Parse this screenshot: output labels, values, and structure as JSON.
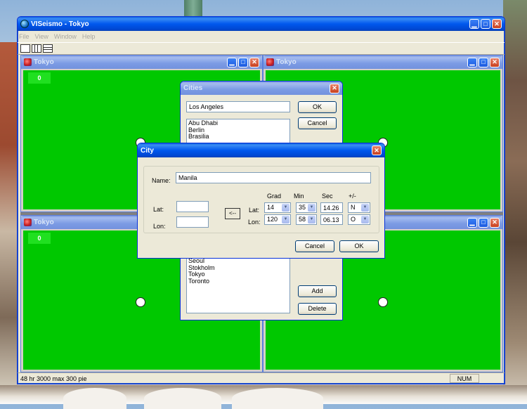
{
  "main_window": {
    "title": "VISeismo - Tokyo",
    "menu": [
      "File",
      "View",
      "Window",
      "Help"
    ],
    "toolbar_icons": [
      "new-document-icon",
      "tile-vertical-icon",
      "tile-horizontal-icon"
    ],
    "status": {
      "text": "48 hr  3000 max  300 pie",
      "num": "NUM"
    }
  },
  "children": [
    {
      "title": "Tokyo",
      "value": "0"
    },
    {
      "title": "Tokyo",
      "value": ""
    },
    {
      "title": "Tokyo",
      "value": "0"
    },
    {
      "title": "",
      "value": ""
    }
  ],
  "cities_dialog": {
    "title": "Cities",
    "search_value": "Los Angeles",
    "ok": "OK",
    "cancel": "Cancel",
    "list_top": [
      "Abu Dhabi",
      "Berlin",
      "Brasilia"
    ],
    "list_bottom": [
      "Seoul",
      "Stokholm",
      "Tokyo",
      "Toronto"
    ],
    "add": "Add",
    "delete": "Delete"
  },
  "city_dialog": {
    "title": "City",
    "name_label": "Name:",
    "name_value": "Manila",
    "lat_label": "Lat:",
    "lon_label": "Lon:",
    "copy_button": "<--",
    "headers": {
      "grad": "Grad",
      "min": "Min",
      "sec": "Sec",
      "sign": "+/-"
    },
    "lat": {
      "label": "Lat:",
      "grad": "14",
      "min": "35",
      "sec": "14.26",
      "sign": "N"
    },
    "lon": {
      "label": "Lon:",
      "grad": "120",
      "min": "58",
      "sec": "06.13",
      "sign": "O"
    },
    "cancel": "Cancel",
    "ok": "OK"
  },
  "colors": {
    "plot_bg": "#00c800",
    "title_active": "#0058ee",
    "title_inactive": "#7b9ae4"
  }
}
